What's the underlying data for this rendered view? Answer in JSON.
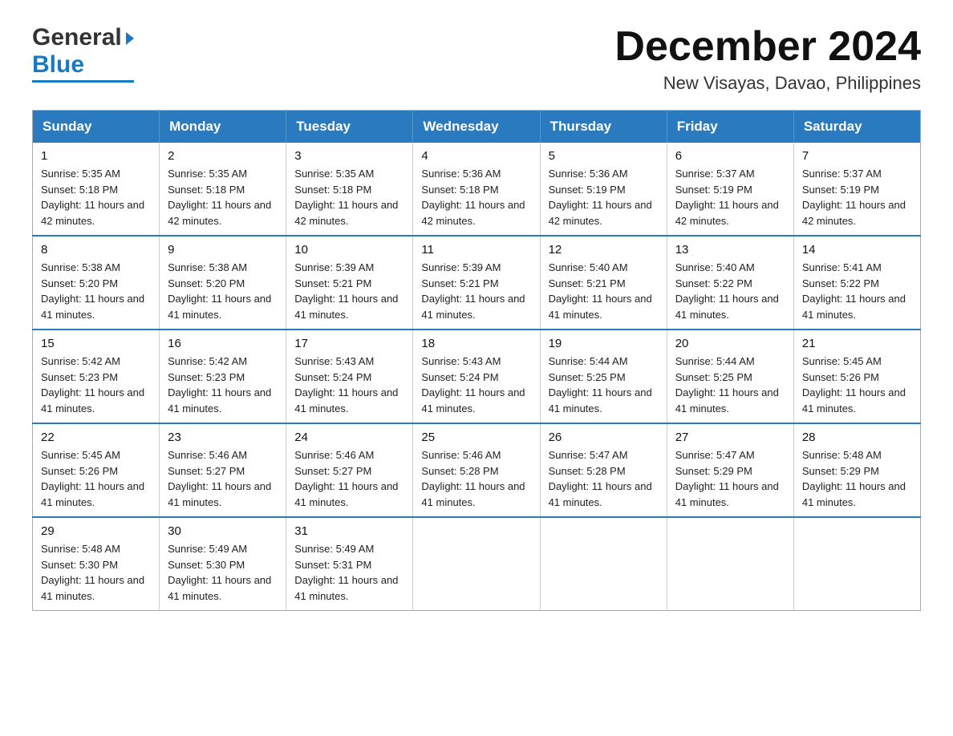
{
  "header": {
    "logo": {
      "text_general": "General",
      "text_blue": "Blue"
    },
    "title": "December 2024",
    "location": "New Visayas, Davao, Philippines"
  },
  "calendar": {
    "days_of_week": [
      "Sunday",
      "Monday",
      "Tuesday",
      "Wednesday",
      "Thursday",
      "Friday",
      "Saturday"
    ],
    "weeks": [
      [
        {
          "day": "1",
          "sunrise": "5:35 AM",
          "sunset": "5:18 PM",
          "daylight": "11 hours and 42 minutes."
        },
        {
          "day": "2",
          "sunrise": "5:35 AM",
          "sunset": "5:18 PM",
          "daylight": "11 hours and 42 minutes."
        },
        {
          "day": "3",
          "sunrise": "5:35 AM",
          "sunset": "5:18 PM",
          "daylight": "11 hours and 42 minutes."
        },
        {
          "day": "4",
          "sunrise": "5:36 AM",
          "sunset": "5:18 PM",
          "daylight": "11 hours and 42 minutes."
        },
        {
          "day": "5",
          "sunrise": "5:36 AM",
          "sunset": "5:19 PM",
          "daylight": "11 hours and 42 minutes."
        },
        {
          "day": "6",
          "sunrise": "5:37 AM",
          "sunset": "5:19 PM",
          "daylight": "11 hours and 42 minutes."
        },
        {
          "day": "7",
          "sunrise": "5:37 AM",
          "sunset": "5:19 PM",
          "daylight": "11 hours and 42 minutes."
        }
      ],
      [
        {
          "day": "8",
          "sunrise": "5:38 AM",
          "sunset": "5:20 PM",
          "daylight": "11 hours and 41 minutes."
        },
        {
          "day": "9",
          "sunrise": "5:38 AM",
          "sunset": "5:20 PM",
          "daylight": "11 hours and 41 minutes."
        },
        {
          "day": "10",
          "sunrise": "5:39 AM",
          "sunset": "5:21 PM",
          "daylight": "11 hours and 41 minutes."
        },
        {
          "day": "11",
          "sunrise": "5:39 AM",
          "sunset": "5:21 PM",
          "daylight": "11 hours and 41 minutes."
        },
        {
          "day": "12",
          "sunrise": "5:40 AM",
          "sunset": "5:21 PM",
          "daylight": "11 hours and 41 minutes."
        },
        {
          "day": "13",
          "sunrise": "5:40 AM",
          "sunset": "5:22 PM",
          "daylight": "11 hours and 41 minutes."
        },
        {
          "day": "14",
          "sunrise": "5:41 AM",
          "sunset": "5:22 PM",
          "daylight": "11 hours and 41 minutes."
        }
      ],
      [
        {
          "day": "15",
          "sunrise": "5:42 AM",
          "sunset": "5:23 PM",
          "daylight": "11 hours and 41 minutes."
        },
        {
          "day": "16",
          "sunrise": "5:42 AM",
          "sunset": "5:23 PM",
          "daylight": "11 hours and 41 minutes."
        },
        {
          "day": "17",
          "sunrise": "5:43 AM",
          "sunset": "5:24 PM",
          "daylight": "11 hours and 41 minutes."
        },
        {
          "day": "18",
          "sunrise": "5:43 AM",
          "sunset": "5:24 PM",
          "daylight": "11 hours and 41 minutes."
        },
        {
          "day": "19",
          "sunrise": "5:44 AM",
          "sunset": "5:25 PM",
          "daylight": "11 hours and 41 minutes."
        },
        {
          "day": "20",
          "sunrise": "5:44 AM",
          "sunset": "5:25 PM",
          "daylight": "11 hours and 41 minutes."
        },
        {
          "day": "21",
          "sunrise": "5:45 AM",
          "sunset": "5:26 PM",
          "daylight": "11 hours and 41 minutes."
        }
      ],
      [
        {
          "day": "22",
          "sunrise": "5:45 AM",
          "sunset": "5:26 PM",
          "daylight": "11 hours and 41 minutes."
        },
        {
          "day": "23",
          "sunrise": "5:46 AM",
          "sunset": "5:27 PM",
          "daylight": "11 hours and 41 minutes."
        },
        {
          "day": "24",
          "sunrise": "5:46 AM",
          "sunset": "5:27 PM",
          "daylight": "11 hours and 41 minutes."
        },
        {
          "day": "25",
          "sunrise": "5:46 AM",
          "sunset": "5:28 PM",
          "daylight": "11 hours and 41 minutes."
        },
        {
          "day": "26",
          "sunrise": "5:47 AM",
          "sunset": "5:28 PM",
          "daylight": "11 hours and 41 minutes."
        },
        {
          "day": "27",
          "sunrise": "5:47 AM",
          "sunset": "5:29 PM",
          "daylight": "11 hours and 41 minutes."
        },
        {
          "day": "28",
          "sunrise": "5:48 AM",
          "sunset": "5:29 PM",
          "daylight": "11 hours and 41 minutes."
        }
      ],
      [
        {
          "day": "29",
          "sunrise": "5:48 AM",
          "sunset": "5:30 PM",
          "daylight": "11 hours and 41 minutes."
        },
        {
          "day": "30",
          "sunrise": "5:49 AM",
          "sunset": "5:30 PM",
          "daylight": "11 hours and 41 minutes."
        },
        {
          "day": "31",
          "sunrise": "5:49 AM",
          "sunset": "5:31 PM",
          "daylight": "11 hours and 41 minutes."
        },
        null,
        null,
        null,
        null
      ]
    ]
  }
}
